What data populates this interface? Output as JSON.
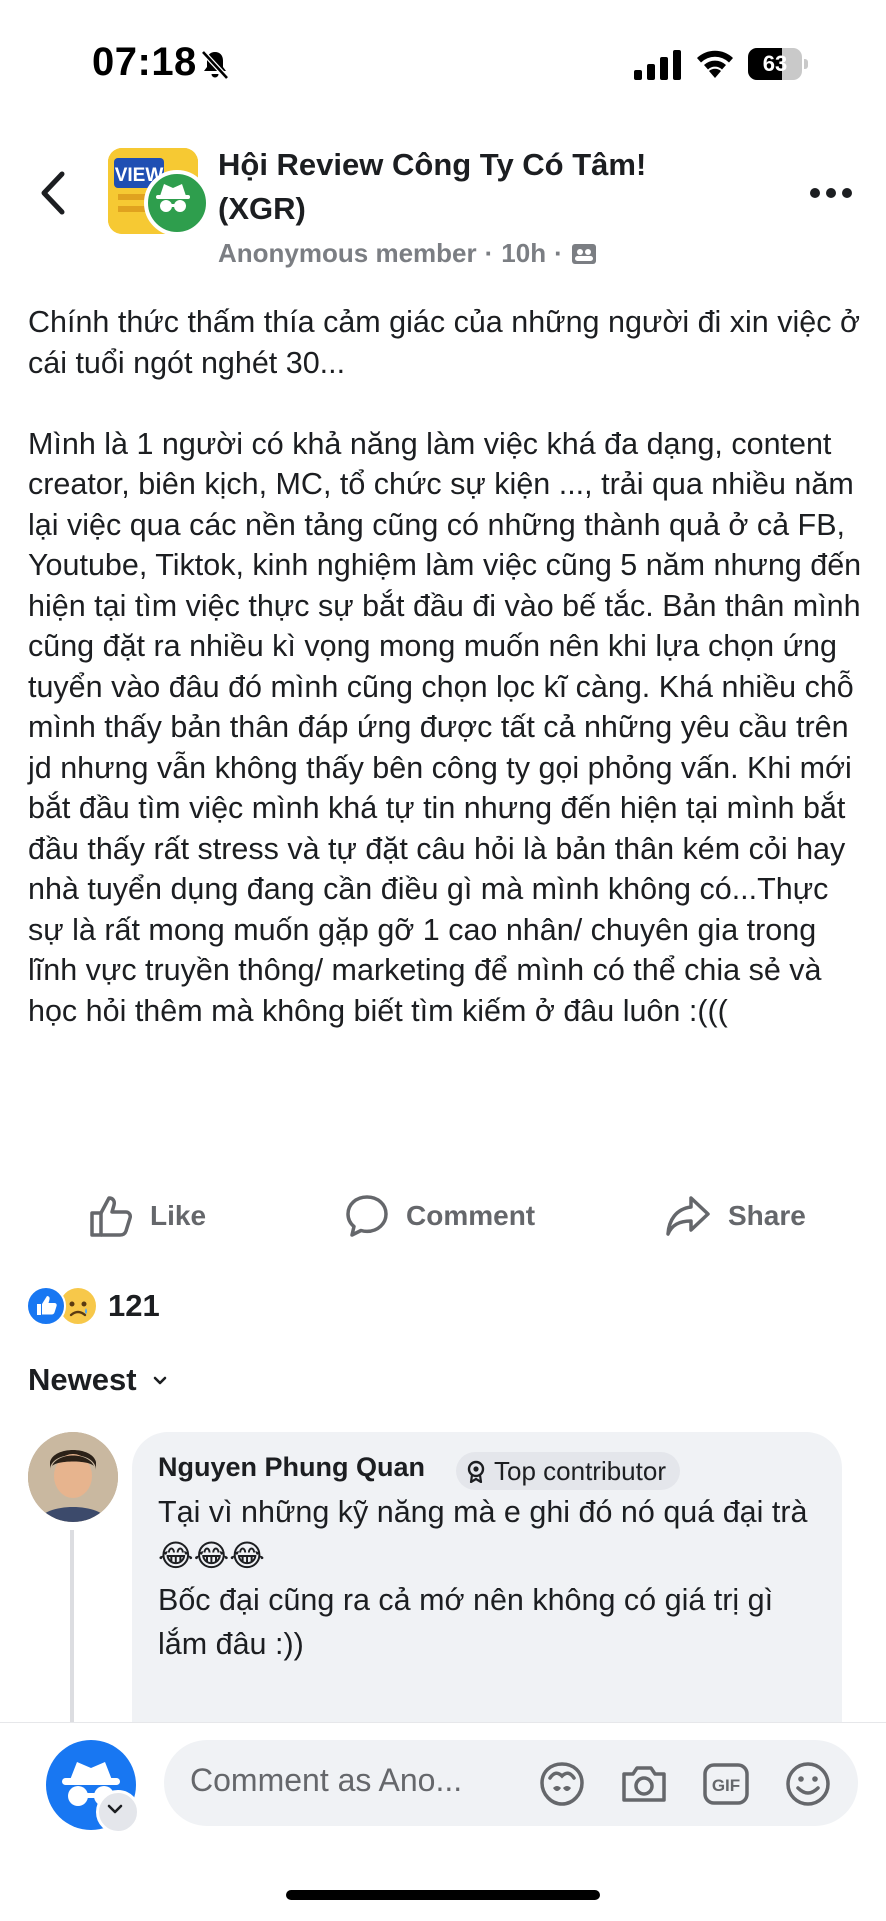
{
  "status_bar": {
    "time": "07:18",
    "battery": "63",
    "battery_level": 0.63
  },
  "post": {
    "group_name": "Hội Review Công Ty Có Tâm! (XGR)",
    "author": "Anonymous member",
    "time_ago": "10h",
    "separator": "·",
    "group_logo_text": "VIEW",
    "body": "Chính thức thấm thía cảm giác của những người đi xin việc ở cái tuổi ngót nghét 30...\n\nMình là 1 người có khả năng làm việc khá đa dạng, content creator, biên kịch, MC, tổ chức sự kiện ..., trải qua nhiều năm lại việc qua các nền tảng cũng có những thành quả ở cả FB, Youtube, Tiktok, kinh nghiệm làm việc cũng 5 năm nhưng đến hiện tại tìm việc thực sự bắt đầu đi vào bế tắc. Bản thân mình cũng đặt ra nhiều kì vọng mong muốn nên khi lựa chọn ứng tuyển vào đâu đó mình cũng chọn lọc kĩ càng. Khá nhiều chỗ mình thấy bản thân đáp ứng được tất cả những yêu cầu trên jd nhưng vẫn không thấy bên công ty gọi phỏng vấn. Khi mới bắt đầu tìm việc mình khá tự tin nhưng đến hiện tại mình bắt đầu thấy rất stress và tự đặt câu hỏi là bản thân kém cỏi hay nhà tuyển dụng đang cần điều gì mà mình không có...Thực sự là rất mong muốn gặp gỡ 1 cao nhân/ chuyên gia trong lĩnh vực truyền thông/ marketing để mình có thể chia sẻ và học hỏi thêm mà không biết tìm kiếm ở đâu luôn :((("
  },
  "actions": {
    "like": "Like",
    "comment": "Comment",
    "share": "Share"
  },
  "reactions": {
    "count": "121",
    "types": [
      "like",
      "sad"
    ]
  },
  "sort": {
    "label": "Newest"
  },
  "comment": {
    "author": "Nguyen Phung Quan",
    "badge": "Top contributor",
    "text": "Tại vì những kỹ năng mà e ghi đó nó quá đại trà 😂😂😂\nBốc đại cũng ra cả mớ nên không có giá trị gì lắm đâu :))"
  },
  "composer": {
    "placeholder": "Comment as Ano...",
    "tools": [
      "avatar-sticker-icon",
      "camera-icon",
      "gif-icon",
      "emoji-icon"
    ],
    "gif_label": "GIF"
  },
  "colors": {
    "brand_blue": "#1877f2",
    "text_secondary": "#65676b",
    "bubble_bg": "#f0f2f5"
  }
}
